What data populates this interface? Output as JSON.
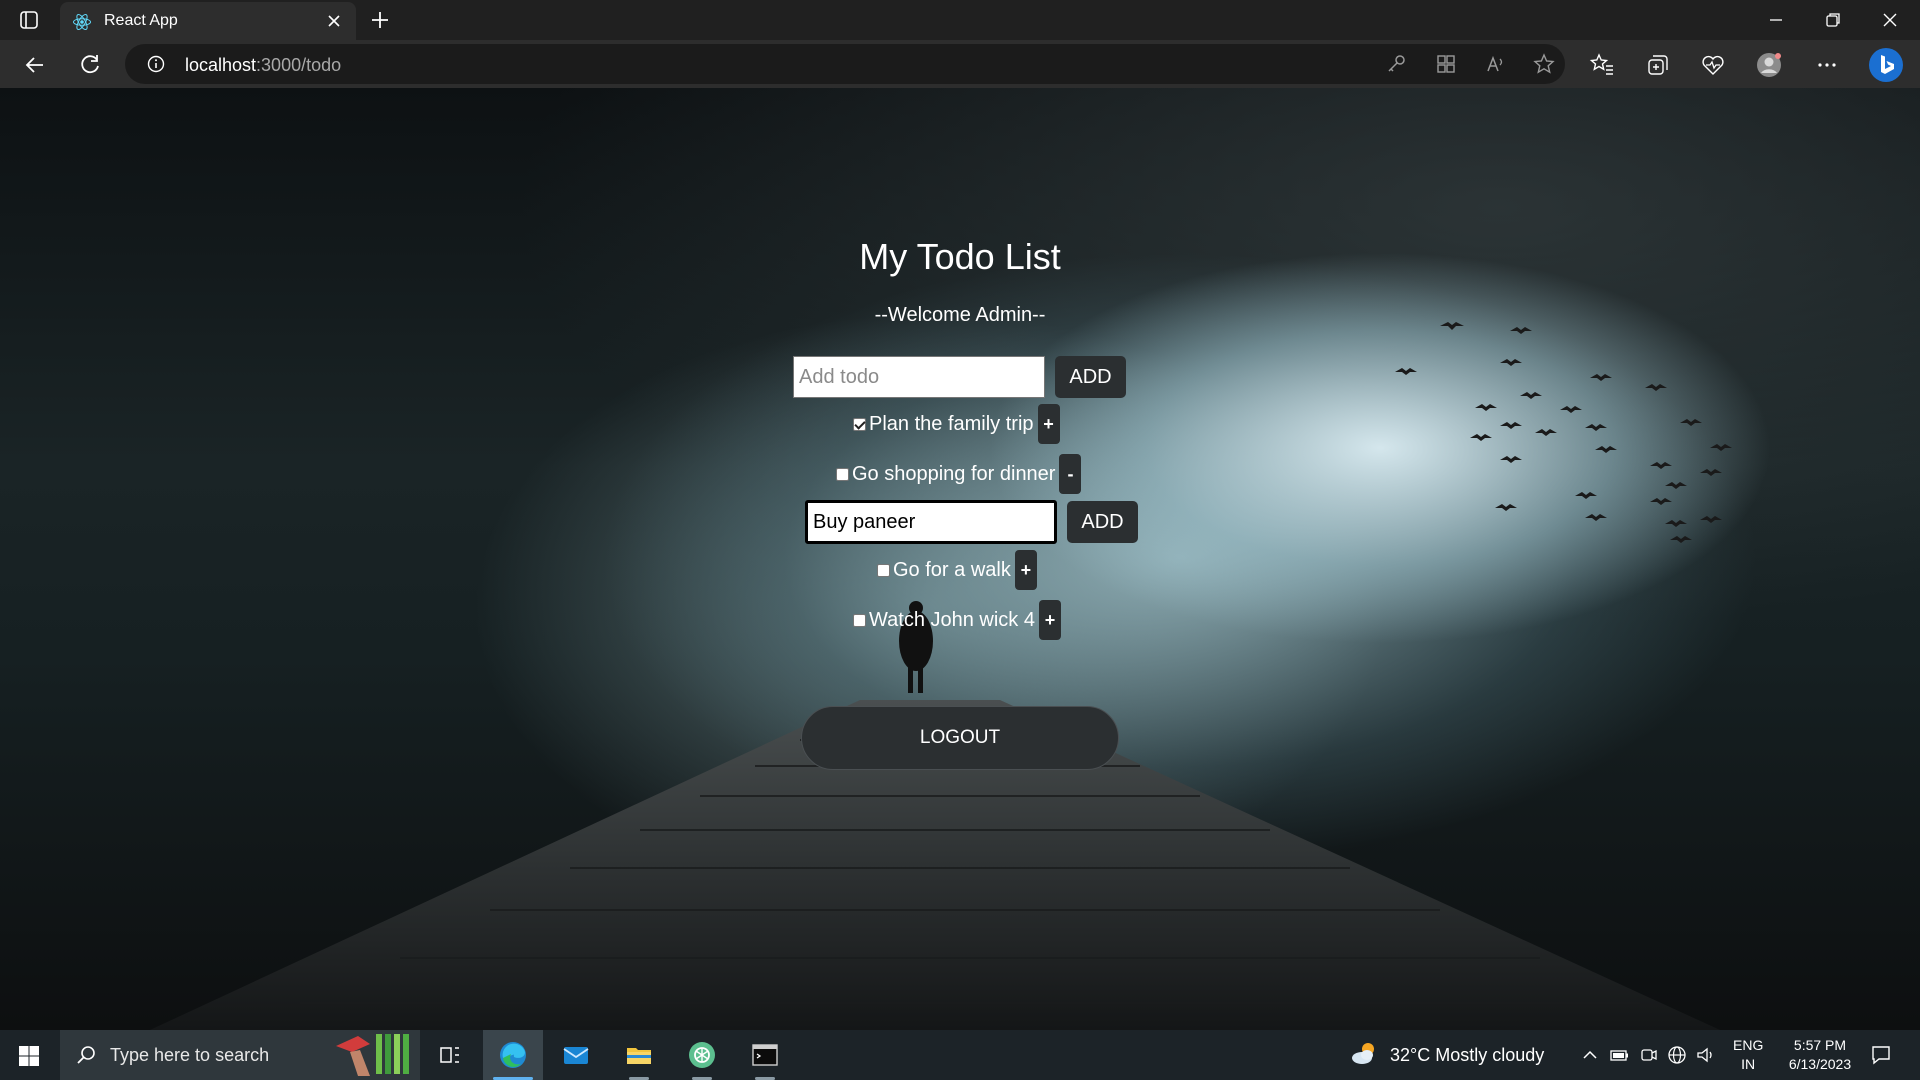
{
  "browser": {
    "tab_title": "React App",
    "url_host": "localhost",
    "url_path": ":3000/todo"
  },
  "app": {
    "title": "My Todo List",
    "welcome": "--Welcome Admin--",
    "add_placeholder": "Add todo",
    "add_label": "ADD",
    "edit_value": "Buy paneer",
    "edit_add_label": "ADD",
    "logout_label": "LOGOUT",
    "todos": [
      {
        "label": "Plan the family trip",
        "checked": true,
        "toggle": "+"
      },
      {
        "label": "Go shopping for dinner",
        "checked": false,
        "toggle": "-"
      },
      {
        "label": "Go for a walk",
        "checked": false,
        "toggle": "+"
      },
      {
        "label": "Watch John wick 4",
        "checked": false,
        "toggle": "+"
      }
    ]
  },
  "taskbar": {
    "search_placeholder": "Type here to search",
    "weather": "32°C  Mostly cloudy",
    "lang_top": "ENG",
    "lang_bottom": "IN",
    "time": "5:57 PM",
    "date": "6/13/2023"
  },
  "colors": {
    "chrome_dark": "#202020",
    "chrome_bar": "#2d2d2d",
    "button_dark": "#2b2f31",
    "taskbar": "#1c2328",
    "taskbar_accent": "#5fb2f0"
  }
}
